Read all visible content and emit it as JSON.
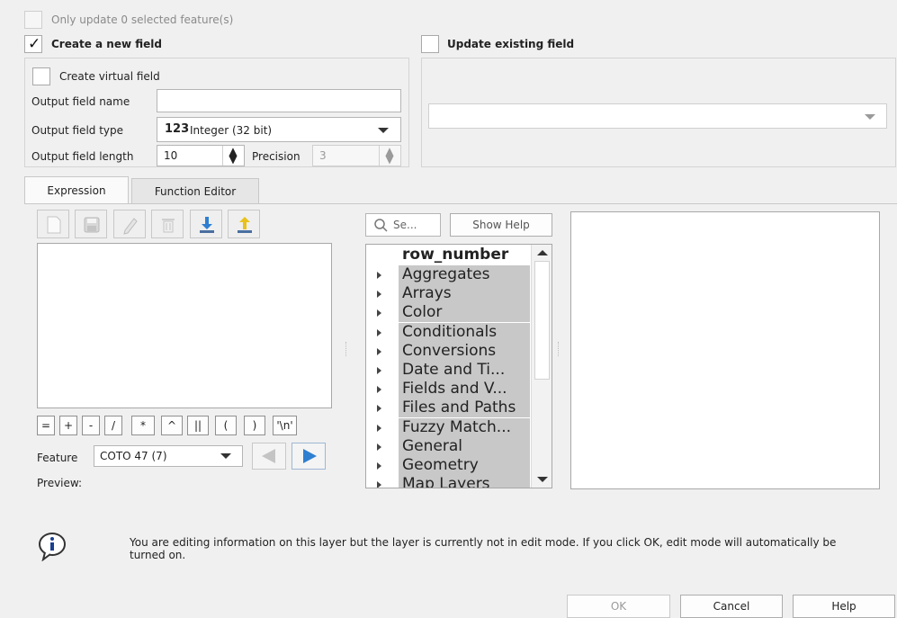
{
  "top": {
    "only_update_label": "Only update 0 selected feature(s)",
    "create_new_field_label": "Create a new field",
    "create_new_field_checked": true,
    "update_existing_label": "Update existing field",
    "update_existing_checked": false
  },
  "new_field": {
    "virtual_label": "Create virtual field",
    "name_label": "Output field name",
    "name_value": "",
    "type_label": "Output field type",
    "type_icon": "123",
    "type_value": "Integer (32 bit)",
    "length_label": "Output field length",
    "length_value": "10",
    "precision_label": "Precision",
    "precision_value": "3"
  },
  "update_field": {
    "combo_value": ""
  },
  "tabs": [
    "Expression",
    "Function Editor"
  ],
  "toolbar_icons": [
    "new-file-icon",
    "save-icon",
    "edit-icon",
    "delete-icon",
    "import-icon",
    "export-icon"
  ],
  "operators": [
    "=",
    "+",
    "-",
    "/",
    "*",
    "^",
    "||",
    "(",
    ")",
    "'\\n'"
  ],
  "feature": {
    "label": "Feature",
    "value": "COTO 47 (7)",
    "preview_label": "Preview:"
  },
  "search": {
    "placeholder": "Se...",
    "show_help_label": "Show Help"
  },
  "functions": {
    "first": "row_number",
    "groups": [
      "Aggregates",
      "Arrays",
      "Color",
      "Conditionals",
      "Conversions",
      "Date and Ti...",
      "Fields and V...",
      "Files and Paths",
      "Fuzzy Match...",
      "General",
      "Geometry",
      "Map Layers"
    ]
  },
  "info": {
    "message": "You are editing information on this layer but the layer is currently not in edit mode. If you click OK, edit mode will automatically be turned on."
  },
  "buttons": {
    "ok": "OK",
    "cancel": "Cancel",
    "help": "Help"
  },
  "colors": {
    "selected_bg": "#c8c8c8",
    "accent_blue": "#2f7fd1",
    "export_yellow": "#e8c21a"
  }
}
